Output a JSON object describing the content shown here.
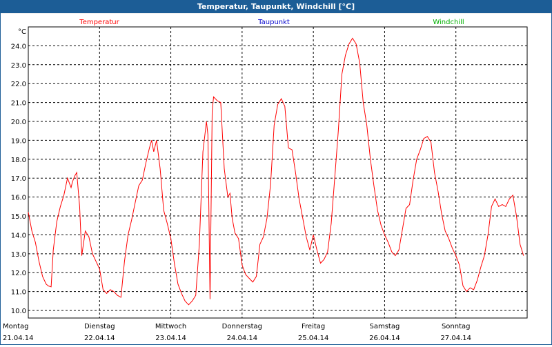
{
  "window": {
    "title": "Temperatur, Taupunkt, Windchill [°C]"
  },
  "chart_data": {
    "type": "line",
    "unit_label": "°C",
    "grid": true,
    "legend_placement": "top",
    "ylim": [
      9.6,
      25.0
    ],
    "yticks": [
      "10.0",
      "11.0",
      "12.0",
      "13.0",
      "14.0",
      "15.0",
      "16.0",
      "17.0",
      "18.0",
      "19.0",
      "20.0",
      "21.0",
      "22.0",
      "23.0",
      "24.0"
    ],
    "xlim": [
      0,
      7.0
    ],
    "xticks": [
      {
        "day": "Montag",
        "date": "21.04.14"
      },
      {
        "day": "Dienstag",
        "date": "22.04.14"
      },
      {
        "day": "Mittwoch",
        "date": "23.04.14"
      },
      {
        "day": "Donnerstag",
        "date": "24.04.14"
      },
      {
        "day": "Freitag",
        "date": "25.04.14"
      },
      {
        "day": "Samstag",
        "date": "26.04.14"
      },
      {
        "day": "Sonntag",
        "date": "27.04.14"
      }
    ],
    "series": [
      {
        "name": "Temperatur",
        "color": "#ff0000",
        "points": [
          [
            0.0,
            15.2
          ],
          [
            0.05,
            14.2
          ],
          [
            0.1,
            13.6
          ],
          [
            0.15,
            12.6
          ],
          [
            0.2,
            11.8
          ],
          [
            0.25,
            11.4
          ],
          [
            0.28,
            11.3
          ],
          [
            0.32,
            11.25
          ],
          [
            0.35,
            13.2
          ],
          [
            0.4,
            14.7
          ],
          [
            0.45,
            15.5
          ],
          [
            0.5,
            16.1
          ],
          [
            0.55,
            17.0
          ],
          [
            0.6,
            16.5
          ],
          [
            0.62,
            16.8
          ],
          [
            0.65,
            17.1
          ],
          [
            0.68,
            17.3
          ],
          [
            0.72,
            15.5
          ],
          [
            0.75,
            12.9
          ],
          [
            0.8,
            14.2
          ],
          [
            0.85,
            13.9
          ],
          [
            0.9,
            13.0
          ],
          [
            0.95,
            12.6
          ],
          [
            1.0,
            12.2
          ],
          [
            1.05,
            11.1
          ],
          [
            1.1,
            10.9
          ],
          [
            1.15,
            11.1
          ],
          [
            1.2,
            11.0
          ],
          [
            1.25,
            10.8
          ],
          [
            1.3,
            10.7
          ],
          [
            1.35,
            12.6
          ],
          [
            1.4,
            14.0
          ],
          [
            1.45,
            14.8
          ],
          [
            1.5,
            15.7
          ],
          [
            1.55,
            16.6
          ],
          [
            1.6,
            16.9
          ],
          [
            1.65,
            17.8
          ],
          [
            1.7,
            18.6
          ],
          [
            1.73,
            19.0
          ],
          [
            1.76,
            18.4
          ],
          [
            1.8,
            19.0
          ],
          [
            1.85,
            17.5
          ],
          [
            1.9,
            15.3
          ],
          [
            1.95,
            14.6
          ],
          [
            2.0,
            13.8
          ],
          [
            2.05,
            12.5
          ],
          [
            2.1,
            11.4
          ],
          [
            2.15,
            10.9
          ],
          [
            2.2,
            10.5
          ],
          [
            2.25,
            10.3
          ],
          [
            2.3,
            10.5
          ],
          [
            2.35,
            10.8
          ],
          [
            2.4,
            13.5
          ],
          [
            2.45,
            18.4
          ],
          [
            2.5,
            20.0
          ],
          [
            2.52,
            19.3
          ],
          [
            2.55,
            10.6
          ],
          [
            2.58,
            20.5
          ],
          [
            2.6,
            21.3
          ],
          [
            2.65,
            21.1
          ],
          [
            2.7,
            21.0
          ],
          [
            2.75,
            17.5
          ],
          [
            2.8,
            16.0
          ],
          [
            2.83,
            16.2
          ],
          [
            2.86,
            14.9
          ],
          [
            2.9,
            14.1
          ],
          [
            2.95,
            13.8
          ],
          [
            3.0,
            12.4
          ],
          [
            3.05,
            11.9
          ],
          [
            3.1,
            11.7
          ],
          [
            3.15,
            11.5
          ],
          [
            3.2,
            11.8
          ],
          [
            3.25,
            13.5
          ],
          [
            3.3,
            13.9
          ],
          [
            3.35,
            14.9
          ],
          [
            3.4,
            16.7
          ],
          [
            3.45,
            19.8
          ],
          [
            3.5,
            20.9
          ],
          [
            3.55,
            21.2
          ],
          [
            3.6,
            20.8
          ],
          [
            3.65,
            18.6
          ],
          [
            3.7,
            18.5
          ],
          [
            3.75,
            17.3
          ],
          [
            3.8,
            15.9
          ],
          [
            3.85,
            14.9
          ],
          [
            3.9,
            13.9
          ],
          [
            3.95,
            13.2
          ],
          [
            4.0,
            14.0
          ],
          [
            4.05,
            13.2
          ],
          [
            4.1,
            12.5
          ],
          [
            4.15,
            12.7
          ],
          [
            4.2,
            13.1
          ],
          [
            4.25,
            14.6
          ],
          [
            4.3,
            17.0
          ],
          [
            4.35,
            19.5
          ],
          [
            4.4,
            22.5
          ],
          [
            4.45,
            23.5
          ],
          [
            4.5,
            24.1
          ],
          [
            4.55,
            24.4
          ],
          [
            4.6,
            24.1
          ],
          [
            4.65,
            23.1
          ],
          [
            4.7,
            21.0
          ],
          [
            4.75,
            19.8
          ],
          [
            4.8,
            18.0
          ],
          [
            4.85,
            16.6
          ],
          [
            4.9,
            15.3
          ],
          [
            4.95,
            14.5
          ],
          [
            5.0,
            14.0
          ],
          [
            5.05,
            13.6
          ],
          [
            5.1,
            13.1
          ],
          [
            5.15,
            12.9
          ],
          [
            5.2,
            13.2
          ],
          [
            5.25,
            14.3
          ],
          [
            5.3,
            15.4
          ],
          [
            5.35,
            15.6
          ],
          [
            5.4,
            16.9
          ],
          [
            5.45,
            18.0
          ],
          [
            5.5,
            18.5
          ],
          [
            5.55,
            19.1
          ],
          [
            5.6,
            19.2
          ],
          [
            5.65,
            18.9
          ],
          [
            5.7,
            17.3
          ],
          [
            5.75,
            16.3
          ],
          [
            5.8,
            15.1
          ],
          [
            5.85,
            14.2
          ],
          [
            5.9,
            13.8
          ],
          [
            5.95,
            13.3
          ],
          [
            6.0,
            12.9
          ],
          [
            6.05,
            12.4
          ],
          [
            6.1,
            11.3
          ],
          [
            6.15,
            11.0
          ],
          [
            6.2,
            11.2
          ],
          [
            6.25,
            11.1
          ],
          [
            6.3,
            11.6
          ],
          [
            6.35,
            12.3
          ],
          [
            6.4,
            12.9
          ],
          [
            6.45,
            14.0
          ],
          [
            6.5,
            15.5
          ],
          [
            6.55,
            15.9
          ],
          [
            6.6,
            15.5
          ],
          [
            6.65,
            15.6
          ],
          [
            6.7,
            15.5
          ],
          [
            6.75,
            15.9
          ],
          [
            6.8,
            16.1
          ],
          [
            6.85,
            15.0
          ],
          [
            6.9,
            13.5
          ],
          [
            6.95,
            12.9
          ]
        ]
      },
      {
        "name": "Taupunkt",
        "color": "#0000cc",
        "points": []
      },
      {
        "name": "Windchill",
        "color": "#00b000",
        "points": []
      }
    ]
  }
}
